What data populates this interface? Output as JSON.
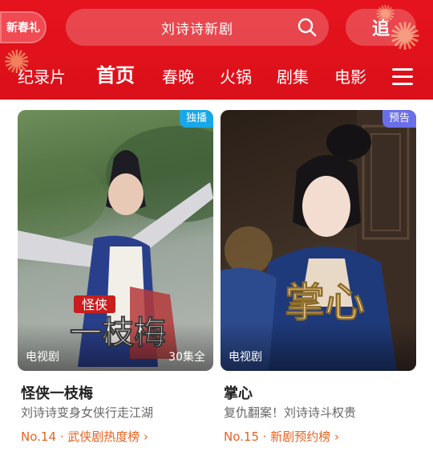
{
  "header": {
    "promo_badge": "新春礼",
    "search_text": "刘诗诗新剧",
    "chase_label": "追",
    "tabs": [
      "纪录片",
      "首页",
      "春晚",
      "火锅",
      "剧集",
      "电影"
    ],
    "active_tab": "首页",
    "colors": {
      "background": "#e5131d",
      "text": "#ffffff"
    }
  },
  "cards": [
    {
      "corner_badge": "独播",
      "artwork_title": "怪侠一枝梅",
      "tag": "电视剧",
      "episodes": "30集全",
      "title": "怪侠一枝梅",
      "description": "刘诗诗变身女侠行走江湖",
      "rank": "No.14 · 武侠剧热度榜 ›"
    },
    {
      "corner_badge": "预告",
      "artwork_title": "掌心",
      "tag": "电视剧",
      "title": "掌心",
      "description": "复仇翻案！刘诗诗斗权贵",
      "rank": "No.15 · 新剧预约榜 ›"
    }
  ],
  "colors": {
    "rank_text": "#e8621f",
    "badge_blue": "#18a7e8",
    "badge_purple": "#6a6ee8"
  }
}
